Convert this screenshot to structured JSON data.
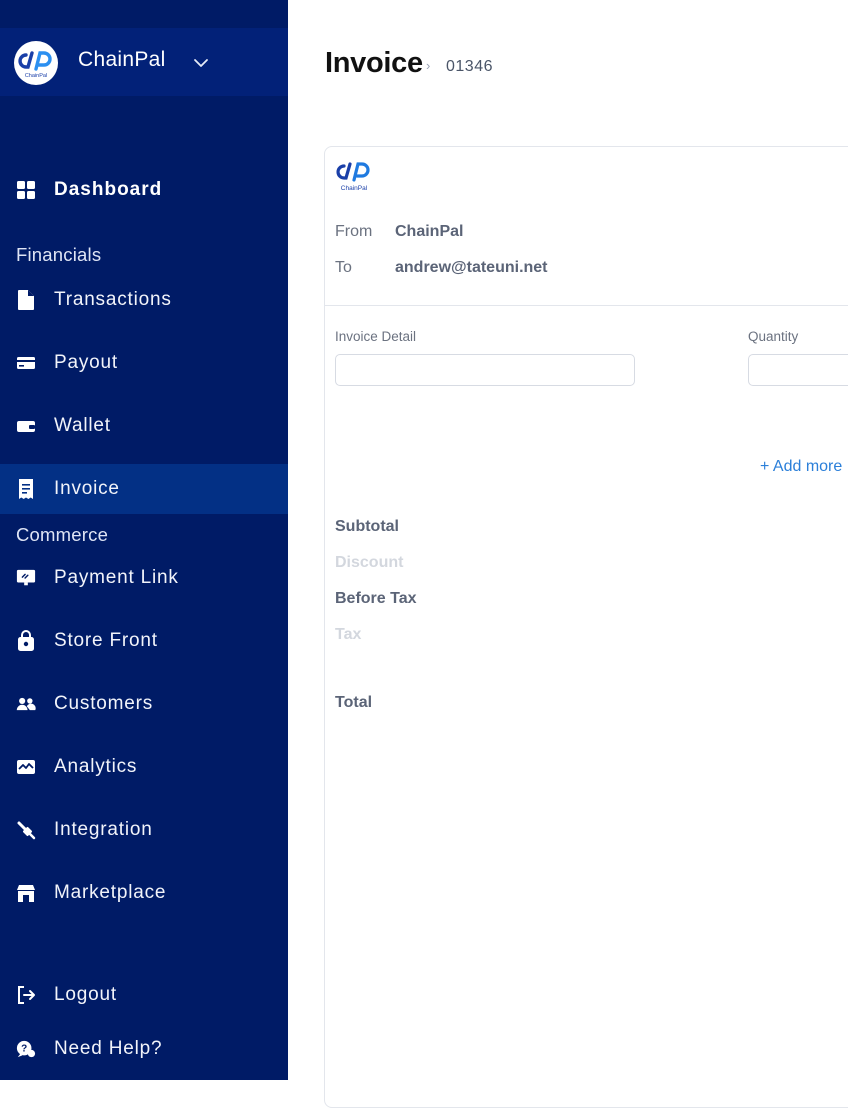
{
  "sidebar": {
    "org_name": "ChainPal",
    "logo_caption": "ChainPal",
    "sections": {
      "financials": "Financials",
      "commerce": "Commerce"
    },
    "items": {
      "dashboard": "Dashboard",
      "transactions": "Transactions",
      "payout": "Payout",
      "wallet": "Wallet",
      "invoice": "Invoice",
      "payment_link": "Payment Link",
      "store_front": "Store Front",
      "customers": "Customers",
      "analytics": "Analytics",
      "integration": "Integration",
      "marketplace": "Marketplace",
      "logout": "Logout",
      "need_help": "Need Help?"
    },
    "active": "invoice"
  },
  "header": {
    "title": "Invoice",
    "separator": "›",
    "invoice_number": "01346"
  },
  "invoice": {
    "logo_caption": "ChainPal",
    "from_label": "From",
    "from_value": "ChainPal",
    "to_label": "To",
    "to_value": "andrew@tateuni.net",
    "detail_label": "Invoice Detail",
    "detail_value": "",
    "quantity_label": "Quantity",
    "quantity_value": "",
    "add_more": "+ Add more",
    "subtotal": "Subtotal",
    "discount": "Discount",
    "before_tax": "Before Tax",
    "tax": "Tax",
    "total": "Total"
  },
  "colors": {
    "sidebar_bg": "#001b66",
    "sidebar_active": "#033085",
    "accent": "#2b7fd9",
    "brand_blue": "#1f7ae0"
  }
}
